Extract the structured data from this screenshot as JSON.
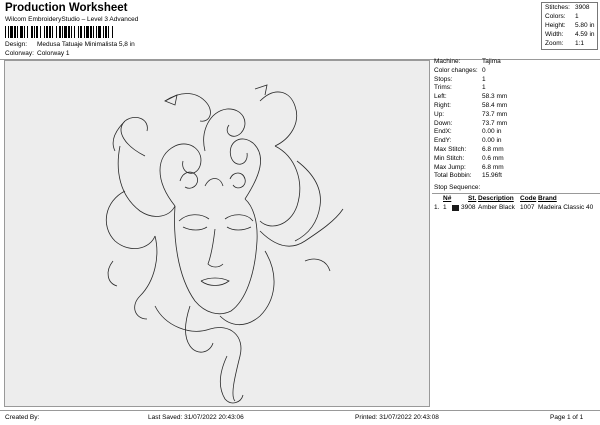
{
  "header": {
    "title": "Production Worksheet",
    "subtitle": "Wilcom EmbroideryStudio – Level 3 Advanced"
  },
  "stats": [
    {
      "label": "Stitches:",
      "value": "3908"
    },
    {
      "label": "Colors:",
      "value": "1"
    },
    {
      "label": "Height:",
      "value": "5.80 in"
    },
    {
      "label": "Width:",
      "value": "4.59 in"
    },
    {
      "label": "Zoom:",
      "value": "1:1"
    }
  ],
  "meta": [
    {
      "label": "Design:",
      "value": "Medusa Tatuaje Minimalista 5,8 in"
    },
    {
      "label": "Colorway:",
      "value": "Colorway 1"
    }
  ],
  "info": [
    {
      "label": "Machine:",
      "value": "Tajima"
    },
    {
      "label": "Color changes:",
      "value": "0"
    },
    {
      "label": "Stops:",
      "value": "1"
    },
    {
      "label": "Trims:",
      "value": "1"
    },
    {
      "label": "Left:",
      "value": "58.3 mm"
    },
    {
      "label": "Right:",
      "value": "58.4 mm"
    },
    {
      "label": "Up:",
      "value": "73.7 mm"
    },
    {
      "label": "Down:",
      "value": "73.7 mm"
    },
    {
      "label": "EndX:",
      "value": "0.00 in"
    },
    {
      "label": "EndY:",
      "value": "0.00 in"
    },
    {
      "label": "Max Stitch:",
      "value": "6.8 mm"
    },
    {
      "label": "Min Stitch:",
      "value": "0.6 mm"
    },
    {
      "label": "Max Jump:",
      "value": "6.8 mm"
    },
    {
      "label": "Total Bobbin:",
      "value": "15.96ft"
    }
  ],
  "stop_sequence": {
    "heading": "Stop Sequence:",
    "columns": [
      "N#",
      "St.",
      "Description",
      "Code",
      "Brand"
    ],
    "rows": [
      {
        "index": "1.",
        "n": "1",
        "color": "#1a1a1a",
        "st": "3908",
        "description": "Amber Black",
        "code": "1007",
        "brand": "Madeira Classic 40"
      }
    ]
  },
  "footer": {
    "created_by": "Created By:",
    "last_saved": "Last Saved: 31/07/2022 20:43:06",
    "printed": "Printed: 31/07/2022 20:43:08",
    "page": "Page 1 of 1"
  }
}
